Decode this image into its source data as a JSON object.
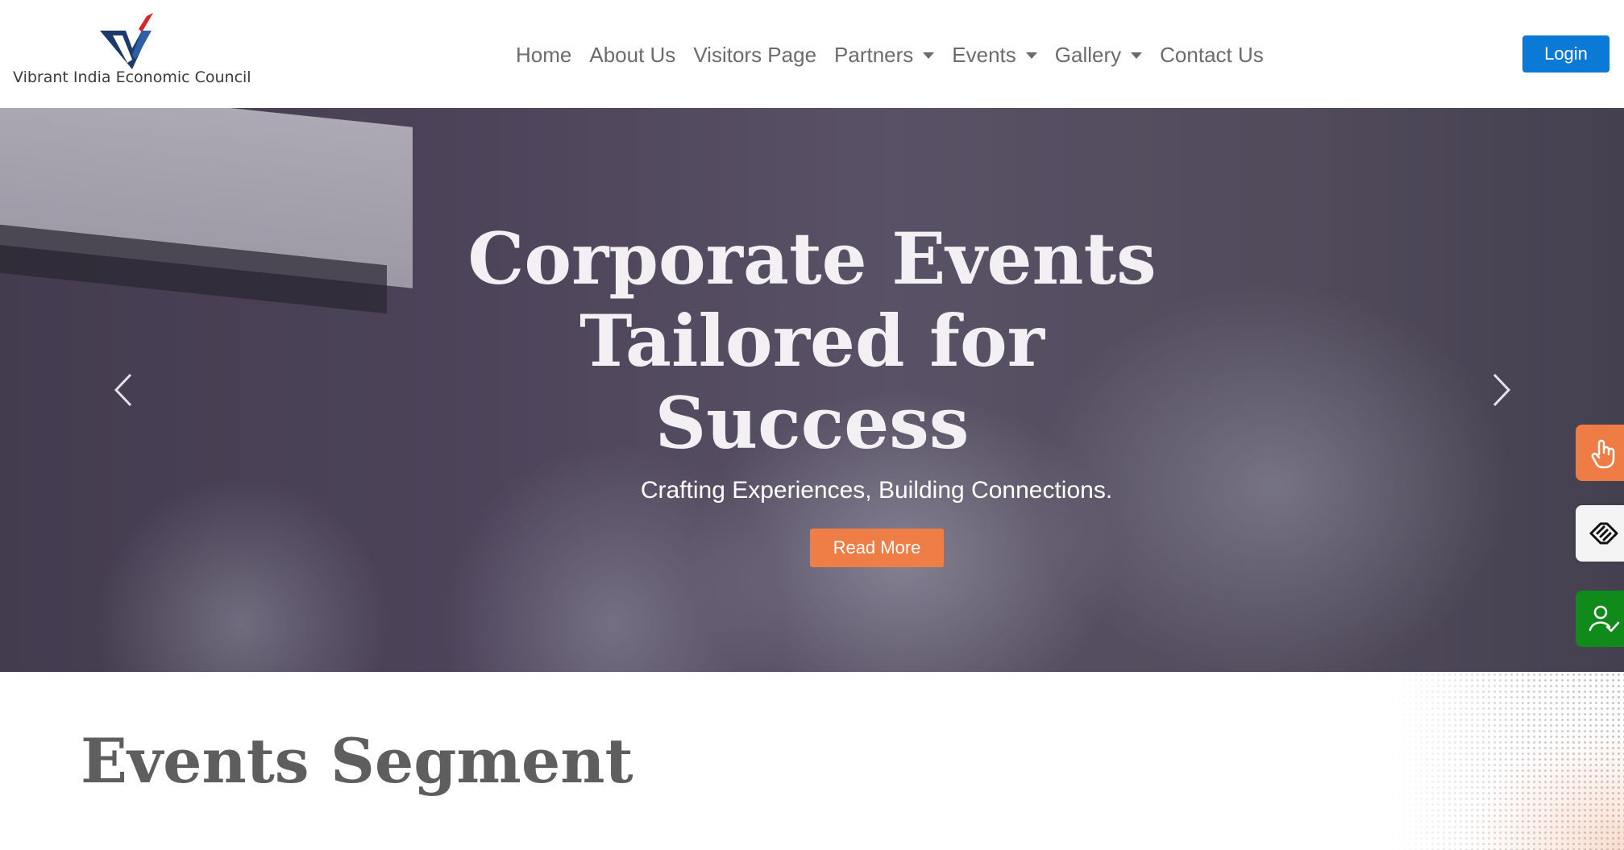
{
  "brand": {
    "name": "Vibrant India Economic Council",
    "logo_icon": "vieco-v-logo",
    "colors": {
      "navy": "#1c3a6b",
      "red": "#d8262e"
    }
  },
  "nav": {
    "items": [
      {
        "label": "Home",
        "dropdown": false
      },
      {
        "label": "About Us",
        "dropdown": false
      },
      {
        "label": "Visitors Page",
        "dropdown": false
      },
      {
        "label": "Partners",
        "dropdown": true
      },
      {
        "label": "Events",
        "dropdown": true
      },
      {
        "label": "Gallery",
        "dropdown": true
      },
      {
        "label": "Contact Us",
        "dropdown": false
      }
    ],
    "login_label": "Login",
    "login_color": "#0a7ad6"
  },
  "hero": {
    "title_lines": [
      "Corporate Events",
      "Tailored for",
      "Success"
    ],
    "subtitle": "Crafting Experiences, Building Connections.",
    "cta_label": "Read More",
    "cta_color": "#ee7d46",
    "prev_icon": "chevron-left-icon",
    "next_icon": "chevron-right-icon"
  },
  "side_buttons": [
    {
      "icon": "tap-hand-icon",
      "color": "#ef7c44"
    },
    {
      "icon": "handshake-icon",
      "color": "#f4f4f4"
    },
    {
      "icon": "user-check-icon",
      "color": "#118a1c"
    }
  ],
  "section": {
    "title": "Events Segment"
  }
}
